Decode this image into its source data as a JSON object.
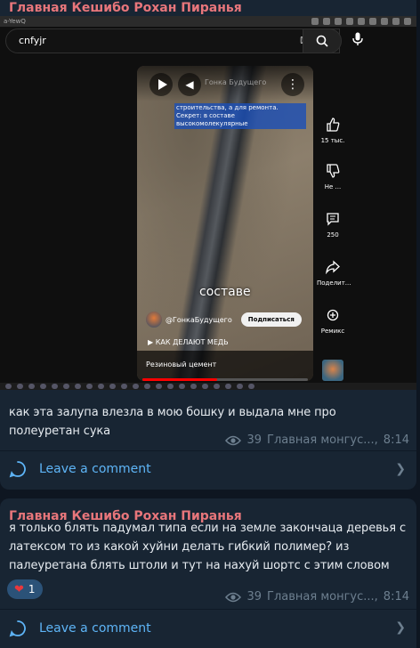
{
  "posts": [
    {
      "author": "Главная Кешибо Рохан Пиранья",
      "screenshot": {
        "tab_text": "a-YewQ",
        "search_query": "cnfyjr",
        "video": {
          "watermark": "Гонка Будущего",
          "overlay_text": "строительства, а для ремонта. Секрет: в составе высокомолекулярные",
          "subtitle": "составе",
          "channel": "@ГонкаБудущего",
          "subscribe": "Подписаться",
          "related": "▶ КАК ДЕЛАЮТ МЕДЬ",
          "title": "Резиновый цемент",
          "progress_fraction": 0.45
        },
        "side_actions": [
          {
            "icon": "thumbs-up-icon",
            "label": "15 тыс."
          },
          {
            "icon": "thumbs-down-icon",
            "label": "Не ..."
          },
          {
            "icon": "comment-icon",
            "label": "250"
          },
          {
            "icon": "share-icon",
            "label": "Поделит..."
          },
          {
            "icon": "remix-icon",
            "label": "Ремикс"
          }
        ]
      },
      "text": "как эта залупа влезла в мою бошку и выдала мне про полеуретан сука",
      "views": "39",
      "signature": "Главная монгус...",
      "time": "8:14",
      "comment_label": "Leave a comment"
    },
    {
      "author": "Главная Кешибо Рохан Пиранья",
      "text": "я только блять падумал типа если на земле закончаца деревья с латексом то из какой хуйни делать гибкий полимер? из палеуретана блять штоли и тут на нахуй шортс с этим словом",
      "reaction": {
        "emoji": "❤",
        "count": "1"
      },
      "views": "39",
      "signature": "Главная монгус...",
      "time": "8:14",
      "comment_label": "Leave a comment"
    }
  ],
  "colors": {
    "background": "#0e1621",
    "bubble": "#182533",
    "author": "#e8767b",
    "link": "#5eb5f7",
    "meta": "#6d7f8f"
  }
}
